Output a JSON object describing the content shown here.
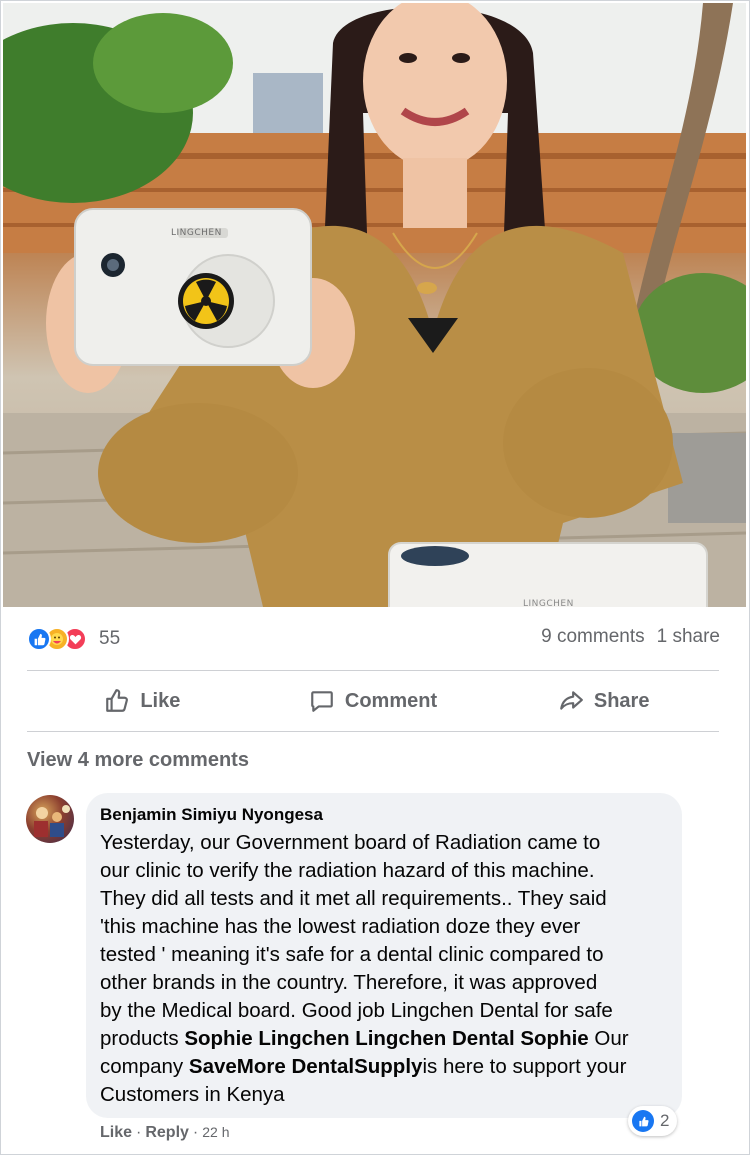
{
  "post": {
    "reactions": {
      "count": "55",
      "types": [
        "like-icon",
        "care-icon",
        "love-icon"
      ]
    },
    "comments_count": "9 comments",
    "shares_count": "1 share",
    "photo": {
      "device_brand": "LINGCHEN",
      "device_brand_2": "LINGCHEN"
    }
  },
  "actions": {
    "like": "Like",
    "comment": "Comment",
    "share": "Share"
  },
  "view_more_comments": "View 4 more comments",
  "comment": {
    "author": "Benjamin Simiyu Nyongesa",
    "text_lines": [
      "Yesterday, our Government board of Radiation came to",
      "our clinic to verify the radiation hazard of this machine.",
      "They did all tests and it met all requirements.. They said",
      "'this machine has the lowest radiation doze they ever",
      "tested ' meaning it's safe for a dental clinic compared to",
      "other brands in the country. Therefore, it was approved",
      "by the Medical board. Good job Lingchen Dental for safe"
    ],
    "line8_prefix": "products ",
    "mention_1": "Sophie Lingchen",
    "mention_2": "Lingchen Dental",
    "mention_3": "Sophie",
    "line8_suffix": " Our",
    "line9_prefix": "company ",
    "mention_4": "SaveMore DentalSupply",
    "line9_suffix": "is here to support your",
    "line10": "Customers in Kenya",
    "reaction_count": "2",
    "meta": {
      "like": "Like",
      "sep1": "·",
      "reply": "Reply",
      "sep2": "·",
      "time": "22 h"
    }
  },
  "colors": {
    "accent": "#1877f2",
    "muted": "#65676b",
    "bubble": "#f0f2f5"
  }
}
